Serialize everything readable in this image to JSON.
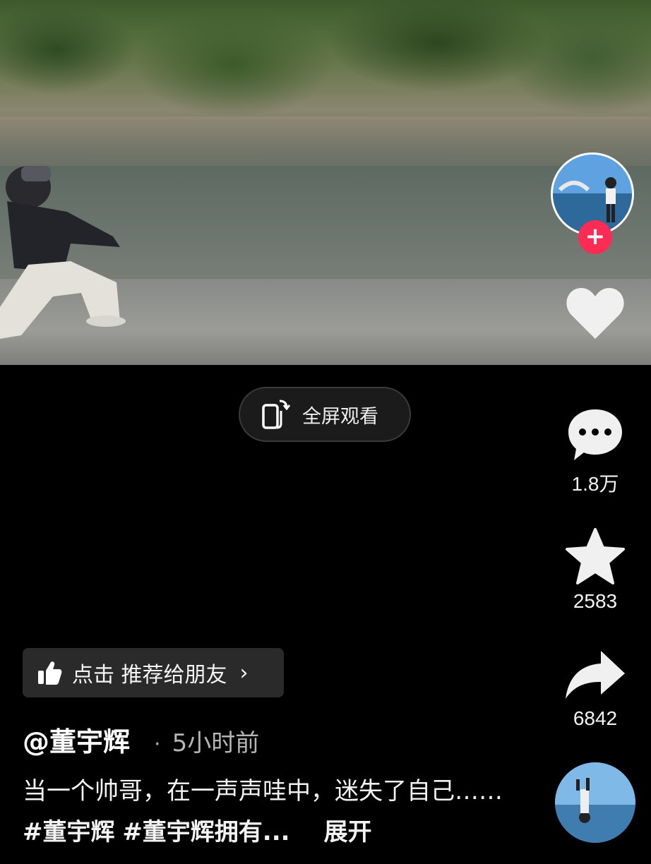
{
  "fullscreen_button": {
    "label": "全屏观看",
    "icon": "rotate-phone-icon"
  },
  "rail": {
    "avatar": {
      "icon": "author-avatar",
      "follow_icon": "plus-icon",
      "follow_label": "+"
    },
    "like": {
      "icon": "heart-icon",
      "count": ""
    },
    "comment": {
      "icon": "comment-icon",
      "count": "1.8万"
    },
    "favorite": {
      "icon": "star-icon",
      "count": "2583"
    },
    "share": {
      "icon": "share-arrow-icon",
      "count": "6842"
    },
    "music": {
      "icon": "music-disc"
    }
  },
  "recommend": {
    "icon": "thumbs-up-icon",
    "label": "点击 推荐给朋友",
    "arrow": "›"
  },
  "post": {
    "author": "@董宇辉",
    "dot": "·",
    "time": "5小时前",
    "text": "当一个帅哥，在一声声哇中，迷失了自己……",
    "tag1": "#董宇辉",
    "tag2": "#董宇辉拥有...",
    "expand": "展开"
  },
  "colors": {
    "follow_accent": "#fe2c55",
    "background": "#000000"
  }
}
